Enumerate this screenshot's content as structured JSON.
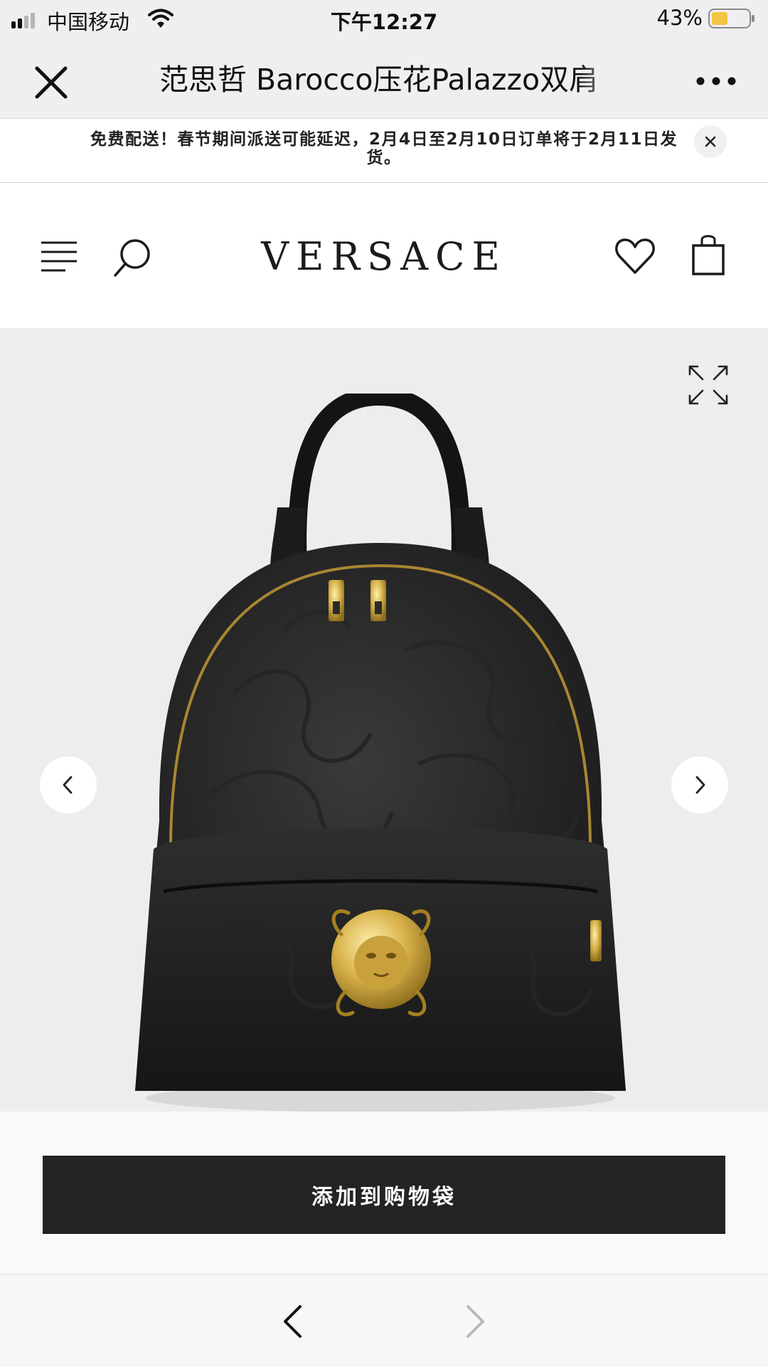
{
  "status_bar": {
    "carrier": "中国移动",
    "time": "下午12:27",
    "battery_percent": "43%",
    "battery_level": 0.43,
    "battery_color": "#f6c443"
  },
  "webview": {
    "title": "范思哲 Barocco压花Palazzo双肩",
    "close_icon": "close-icon",
    "more_icon": "more-icon"
  },
  "banner": {
    "text": "免费配送！春节期间派送可能延迟，2月4日至2月10日订单将于2月11日发货。",
    "close_label": "×"
  },
  "site_header": {
    "logo": "VERSACE",
    "icons": [
      "menu-icon",
      "search-icon",
      "heart-icon",
      "shopping-bag-icon"
    ]
  },
  "gallery": {
    "icons": [
      "expand-icon",
      "chevron-left-icon",
      "chevron-right-icon"
    ]
  },
  "cta": {
    "add_to_bag_label": "添加到购物袋",
    "button_color": "#232323"
  },
  "browser_nav": {
    "back_icon": "back-arrow-icon",
    "forward_icon": "forward-arrow-icon",
    "forward_enabled": false
  }
}
